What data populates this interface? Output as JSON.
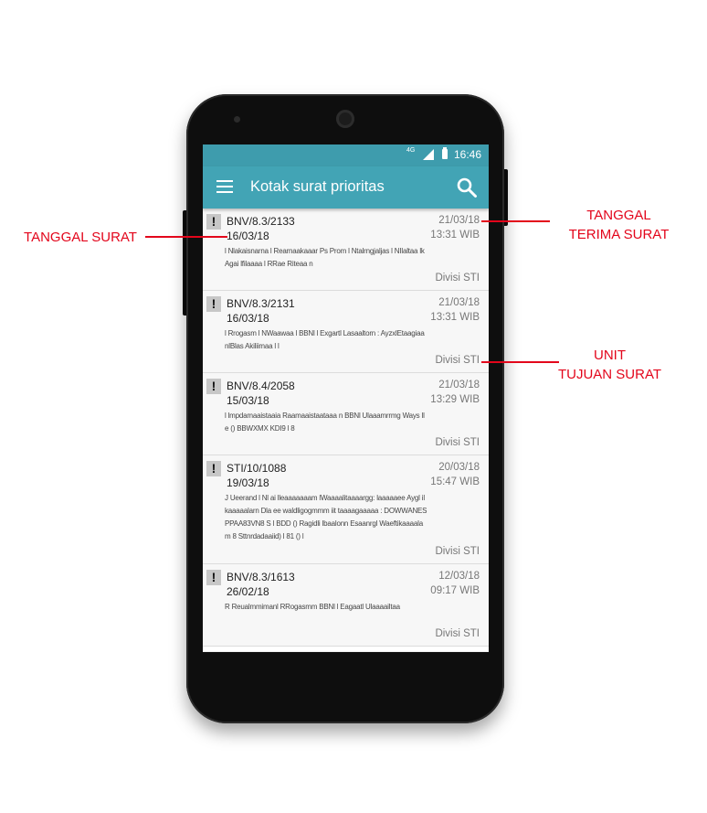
{
  "status_bar": {
    "network": "4G",
    "time": "16:46"
  },
  "app_bar": {
    "title": "Kotak surat prioritas",
    "menu_icon": "hamburger-menu-icon",
    "search_icon": "search-icon"
  },
  "letters": [
    {
      "priority_mark": "!",
      "number": "BNV/8.3/2133",
      "letter_date": "16/03/18",
      "preview": "l Nlakaisnarna l Rearnaakaaar Ps Prom l Ntalrngjaljas l NIlaltaa lk Agai lfilaaaa l RRae Riteaa n",
      "received_date": "21/03/18",
      "received_time": "13:31 WIB",
      "division": "Divisi STI"
    },
    {
      "priority_mark": "!",
      "number": "BNV/8.3/2131",
      "letter_date": "16/03/18",
      "preview": "l Rrogasm l NWaawaa l BBNl l Exgartl Lasaaltorn : AyzxlEtaagiaanlBlas Akiliimaa l l",
      "received_date": "21/03/18",
      "received_time": "13:31 WIB",
      "division": "Divisi STI"
    },
    {
      "priority_mark": "!",
      "number": "BNV/8.4/2058",
      "letter_date": "15/03/18",
      "preview": "l lmpdamaaistaaia Raamaaistaataaa n BBNl Ulaaamrrmg Ways lle () BBWXMX KDI9 l 8",
      "received_date": "21/03/18",
      "received_time": "13:29 WIB",
      "division": "Divisi STI"
    },
    {
      "priority_mark": "!",
      "number": "STI/10/1088",
      "letter_date": "19/03/18",
      "preview": "J Ueerand l Nl ai lleaaaaaaam lWaaaalitaaaargg: laaaaaee Aygl ilkaaaaalarn Dla ee waldligogmmm iit taaaagaaaaa : DOWWANESPPAA83VN8 S l BDD () Ragidli lbaalonn Esaanrgl Waeftikaaaalam 8 Sttnrdadaaiid) l 81 () l",
      "received_date": "20/03/18",
      "received_time": "15:47 WIB",
      "division": "Divisi STI"
    },
    {
      "priority_mark": "!",
      "number": "BNV/8.3/1613",
      "letter_date": "26/02/18",
      "preview": "R Reualmmimanl RRogasmm BBNl l Eagaatl Ulaaaailtaa",
      "received_date": "12/03/18",
      "received_time": "09:17 WIB",
      "division": "Divisi STI"
    }
  ],
  "annotations": {
    "letter_date": "TANGGAL SURAT",
    "received_date_line1": "TANGGAL",
    "received_date_line2": "TERIMA SURAT",
    "unit_line1": "UNIT",
    "unit_line2": "TUJUAN SURAT",
    "color": "#e3051b"
  },
  "colors": {
    "status_bar": "#3e9cad",
    "app_bar": "#42a4b5",
    "list_bg": "#f7f7f7"
  }
}
